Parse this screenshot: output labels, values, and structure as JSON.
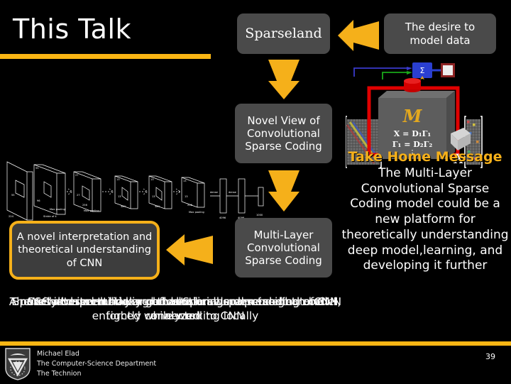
{
  "slide": {
    "title": "This Talk",
    "page_number": "39",
    "accent_color": "#FAB614",
    "box_color": "#4a4a4a",
    "highlight_border": "#F5B01A",
    "background": "#000000"
  },
  "boxes": {
    "sparseland": "Sparseland",
    "desire": "The desire to model data",
    "novel_view": "Novel View of Convolutional Sparse Coding",
    "mlcsc": "Multi-Layer Convolutional Sparse Coding",
    "cnn_interpretation": "A novel interpretation and theoretical understanding of CNN"
  },
  "icons": {
    "arrow_left_top": "arrow-left-icon",
    "arrow_down_sparseland": "arrow-down-icon",
    "arrow_down_novel": "arrow-down-icon",
    "arrow_left_mlcsc": "arrow-left-icon",
    "logo": "technion-shield-logo",
    "sigma_block": "sigma-icon"
  },
  "right_diagram": {
    "model_label": "M",
    "equation_1": "X = D₁Γ₁",
    "equation_2": "Γ₁ = D₂Γ₂",
    "equation_3": "⋮",
    "output_label": "X",
    "sigma": "Σ"
  },
  "take_home": {
    "title": "Take Home Message",
    "body": "The Multi-Layer Convolutional Sparse Coding model could be a new platform for theoretically understanding deep model,learning, and developing it further"
  },
  "overlapping_lines": [
    "We have seen how a global Sparseland model can be enforced while working locally",
    "The result: a multi-layer convolutional sparse coding model, tightly connected to CNN",
    "A novel interpretation and theoretical understanding of CNN",
    "CSC and its multi-layered version were presented and analyzed",
    "Sparsity-based modeling of data brings new insight to CNN"
  ],
  "footer": {
    "name": "Michael Elad",
    "department": "The Computer-Science Department",
    "institution": "The Technion"
  }
}
